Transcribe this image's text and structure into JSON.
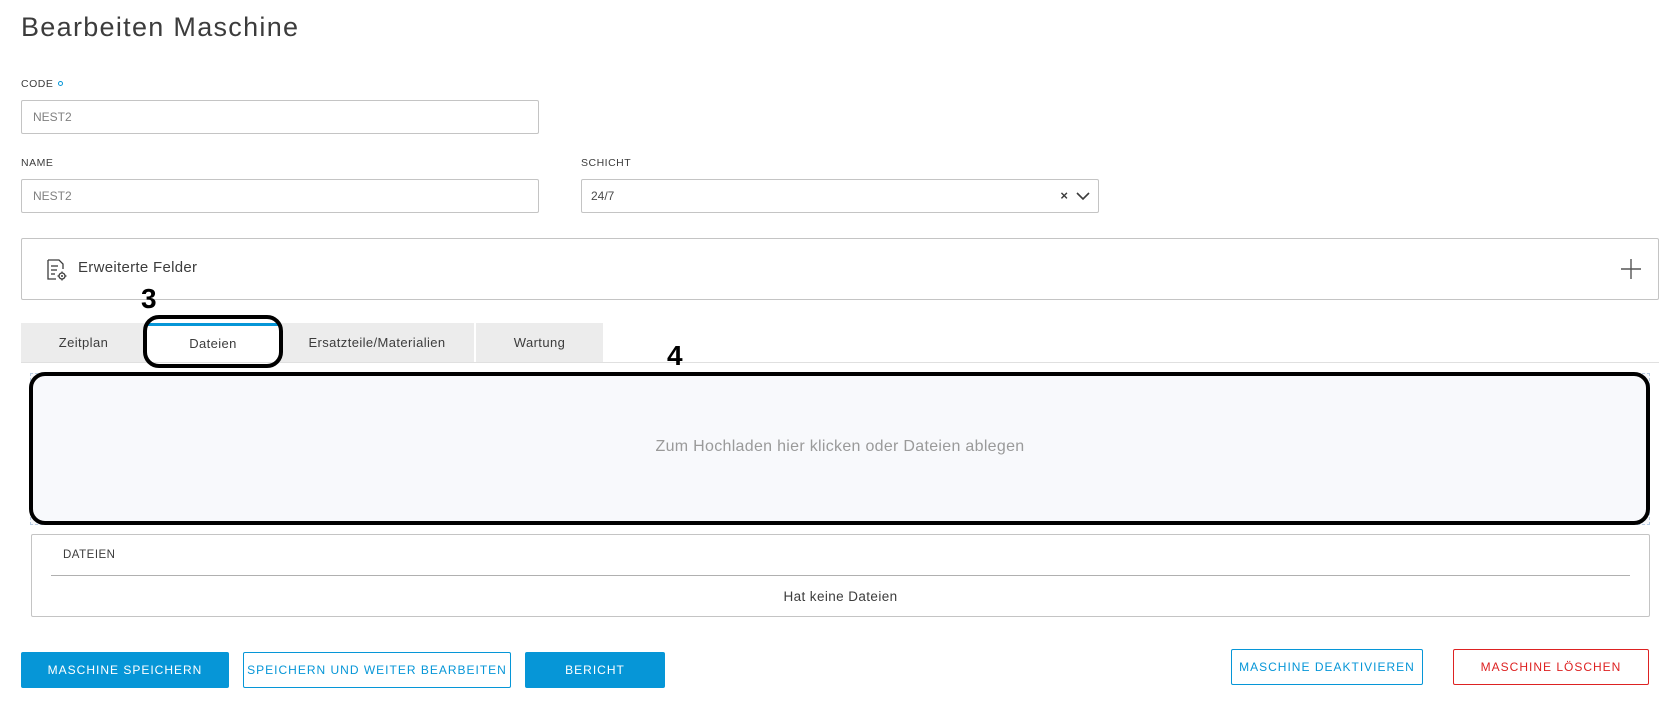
{
  "page": {
    "title": "Bearbeiten Maschine"
  },
  "form": {
    "code": {
      "label": "CODE",
      "value": "NEST2"
    },
    "name": {
      "label": "NAME",
      "value": "NEST2"
    },
    "shift": {
      "label": "SCHICHT",
      "value": "24/7",
      "clear": "×"
    }
  },
  "accordion": {
    "label": "Erweiterte Felder"
  },
  "tabs": [
    {
      "label": "Zeitplan"
    },
    {
      "label": "Dateien"
    },
    {
      "label": "Ersatzteile/Materialien"
    },
    {
      "label": "Wartung"
    }
  ],
  "annotations": {
    "tab_marker": "3",
    "dropzone_marker": "4"
  },
  "dropzone": {
    "text": "Zum Hochladen hier klicken oder Dateien ablegen"
  },
  "files": {
    "header": "DATEIEN",
    "empty": "Hat keine Dateien"
  },
  "buttons": {
    "save": "MASCHINE SPEICHERN",
    "save_continue": "SPEICHERN UND WEITER BEARBEITEN",
    "report": "BERICHT",
    "deactivate": "MASCHINE DEAKTIVIEREN",
    "delete": "MASCHINE LÖSCHEN"
  },
  "colors": {
    "accent": "#0696d7",
    "danger": "#dd2222"
  }
}
